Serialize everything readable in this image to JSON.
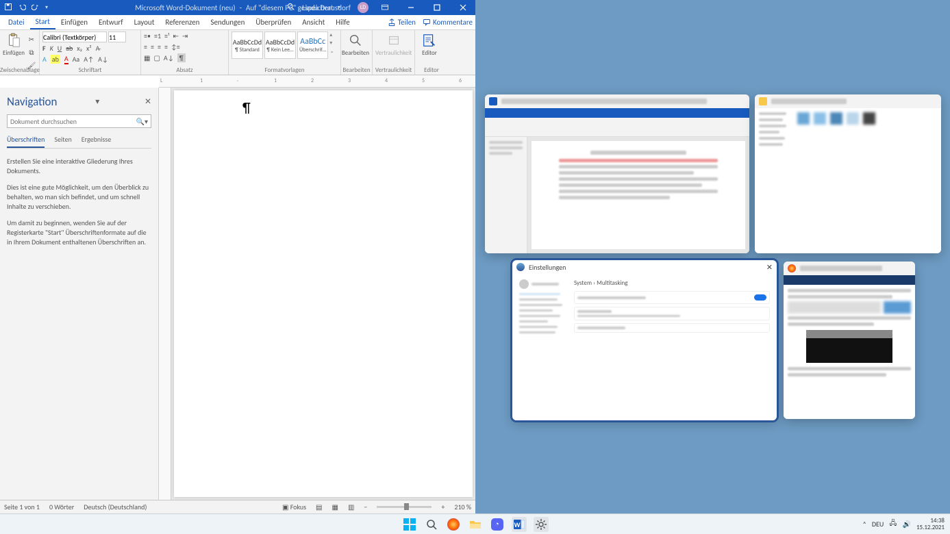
{
  "titlebar": {
    "title_app": "Microsoft Word-Dokument (neu)",
    "title_sep": "-",
    "title_loc": "Auf \"diesem PC\" gespeichert",
    "user": "Linda Drausdorf",
    "user_initials": "LD"
  },
  "tabs": {
    "datei": "Datei",
    "start": "Start",
    "einfuegen": "Einfügen",
    "entwurf": "Entwurf",
    "layout": "Layout",
    "referenzen": "Referenzen",
    "sendungen": "Sendungen",
    "ueberpruefen": "Überprüfen",
    "ansicht": "Ansicht",
    "hilfe": "Hilfe",
    "teilen": "Teilen",
    "kommentare": "Kommentare"
  },
  "ribbon": {
    "zwischenablage": "Zwischenablage",
    "einfuegen": "Einfügen",
    "schriftart": "Schriftart",
    "absatz": "Absatz",
    "formatvorlagen": "Formatvorlagen",
    "bearbeiten": "Bearbeiten",
    "vertraulichkeit": "Vertraulichkeit",
    "vertraulichkeit_btn": "Vertraulichkeit",
    "editor": "Editor",
    "editor_btn": "Editor",
    "font_name": "Calibri (Textkörper)",
    "font_size": "11",
    "style_sample": "AaBbCcDd",
    "style_standard": "¶ Standard",
    "style_kein": "¶ Kein Lee…",
    "style_ueber": "Überschrif…"
  },
  "nav": {
    "title": "Navigation",
    "search_ph": "Dokument durchsuchen",
    "tab_ueberschriften": "Überschriften",
    "tab_seiten": "Seiten",
    "tab_ergebnisse": "Ergebnisse",
    "p1": "Erstellen Sie eine interaktive Gliederung Ihres Dokuments.",
    "p2": "Dies ist eine gute Möglichkeit, um den Überblick zu behalten, wo man sich befindet, und um schnell Inhalte zu verschieben.",
    "p3": "Um damit zu beginnen, wenden Sie auf der Registerkarte \"Start\" Überschriftenformate auf die in Ihrem Dokument enthaltenen Überschriften an."
  },
  "ruler_ticks": [
    "1",
    "2",
    "3",
    "4",
    "5",
    "6"
  ],
  "status": {
    "page": "Seite 1 von 1",
    "words": "0 Wörter",
    "lang": "Deutsch (Deutschland)",
    "focus": "Fokus",
    "zoom": "210 %"
  },
  "snap": {
    "settings_title": "Einstellungen",
    "settings_breadcrumb": "System  ›  Multitasking"
  },
  "tray": {
    "lang": "DEU",
    "time": "14:38",
    "date": "15.12.2021"
  }
}
